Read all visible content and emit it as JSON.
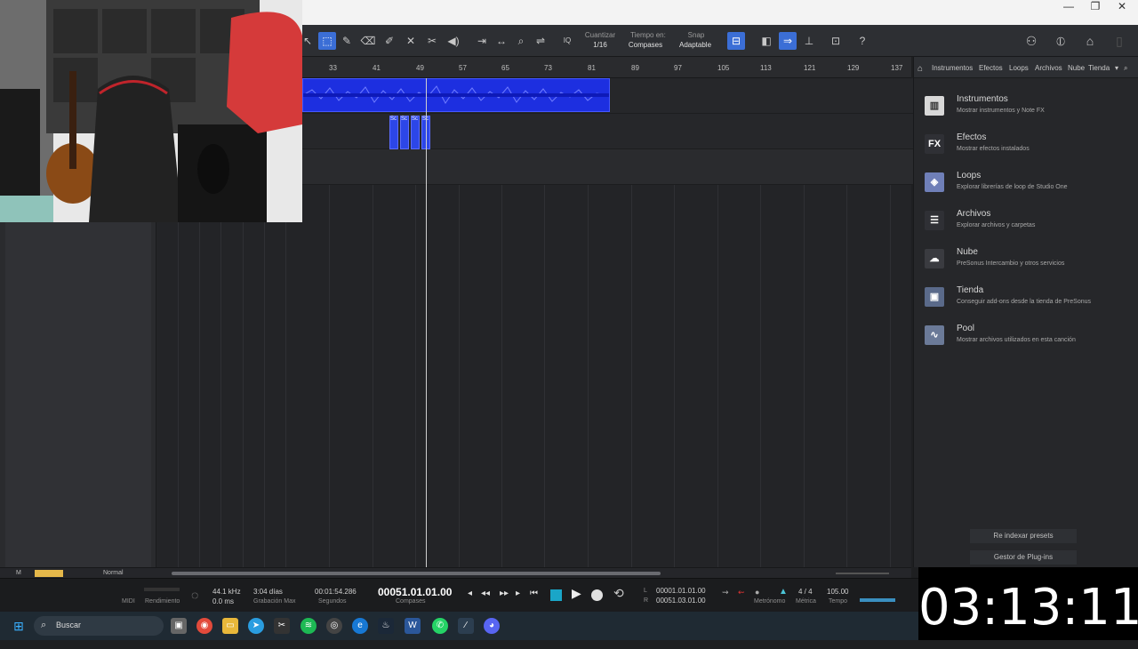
{
  "window": {
    "min": "—",
    "restore": "❐",
    "close": "✕"
  },
  "toolbar": {
    "quantize_label": "Cuantizar",
    "quantize_value": "1/16",
    "timebase_label": "Tiempo en:",
    "timebase_value": "Compases",
    "snap_label": "Snap",
    "snap_value": "Adaptable",
    "iq": "IQ",
    "help": "?"
  },
  "ruler": [
    "33",
    "41",
    "49",
    "57",
    "65",
    "73",
    "81",
    "89",
    "97",
    "105",
    "113",
    "121",
    "129",
    "137"
  ],
  "clips": {
    "small_label": "Sc"
  },
  "browser": {
    "tabs": [
      "Instrumentos",
      "Efectos",
      "Loops",
      "Archivos",
      "Nube",
      "Tienda"
    ],
    "items": [
      {
        "title": "Instrumentos",
        "sub": "Mostrar instrumentos y Note FX",
        "icon": "piano-icon",
        "glyph": "▥"
      },
      {
        "title": "Efectos",
        "sub": "Mostrar efectos instalados",
        "icon": "fx-icon",
        "glyph": "FX"
      },
      {
        "title": "Loops",
        "sub": "Explorar librerías de loop de Studio One",
        "icon": "loops-icon",
        "glyph": "◈"
      },
      {
        "title": "Archivos",
        "sub": "Explorar archivos y carpetas",
        "icon": "files-icon",
        "glyph": "☰"
      },
      {
        "title": "Nube",
        "sub": "PreSonus Intercambio y otros servicios",
        "icon": "cloud-icon",
        "glyph": "☁"
      },
      {
        "title": "Tienda",
        "sub": "Conseguir add-ons desde la tienda de PreSonus",
        "icon": "store-icon",
        "glyph": "▣"
      },
      {
        "title": "Pool",
        "sub": "Mostrar archivos utilizados en esta canción",
        "icon": "pool-icon",
        "glyph": "∿"
      }
    ],
    "reindex": "Re indexar presets",
    "plugin_manager": "Gestor de Plug-ins"
  },
  "hscroll": {
    "m": "M",
    "mode": "Normal"
  },
  "transport": {
    "midi": "MIDI",
    "performance": "Rendimiento",
    "samplerate": "44.1 kHz",
    "latency": "0.0 ms",
    "rec_days": "3:04 días",
    "rec_max": "Grabación Max",
    "seconds_value": "00:01:54.286",
    "seconds_label": "Segundos",
    "position": "00051.01.01.00",
    "position_label": "Compases",
    "loop_l": "00001.01.01.00",
    "loop_r": "00051.03.01.00",
    "l": "L",
    "r": "R",
    "metronome": "Metrónomo",
    "meter_value": "4 / 4",
    "meter_label": "Métrica",
    "tempo_value": "105.00",
    "tempo_label": "Tempo"
  },
  "taskbar": {
    "search": "Buscar"
  },
  "clock": "03:13:11"
}
